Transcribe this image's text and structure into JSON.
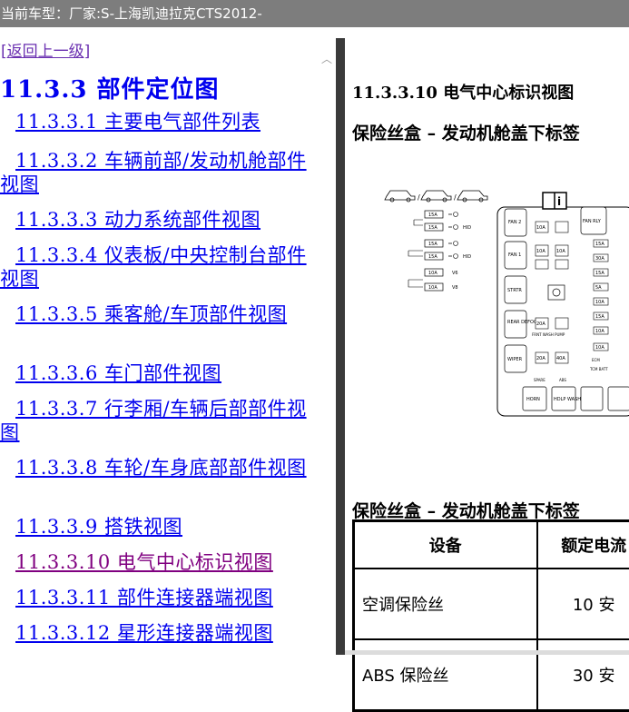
{
  "window": {
    "title": "当前车型：厂家:S-上海凯迪拉克CTS2012-"
  },
  "nav": {
    "back_label": "[返回上一级]",
    "section_title": "11.3.3 部件定位图",
    "items": [
      {
        "label": "11.3.3.1 主要电气部件列表",
        "visited": false
      },
      {
        "label": "11.3.3.2 车辆前部/发动机舱部件视图",
        "visited": false
      },
      {
        "label": "11.3.3.3 动力系统部件视图",
        "visited": false
      },
      {
        "label": "11.3.3.4 仪表板/中央控制台部件视图",
        "visited": false
      },
      {
        "label": "11.3.3.5 乘客舱/车顶部件视图",
        "visited": false
      },
      {
        "label": "11.3.3.6 车门部件视图",
        "visited": false
      },
      {
        "label": "11.3.3.7 行李厢/车辆后部部件视图",
        "visited": false
      },
      {
        "label": "11.3.3.8 车轮/车身底部部件视图",
        "visited": false
      },
      {
        "label": "11.3.3.9 搭铁视图",
        "visited": false
      },
      {
        "label": "11.3.3.10 电气中心标识视图",
        "visited": true
      },
      {
        "label": "11.3.3.11 部件连接器端视图",
        "visited": false
      },
      {
        "label": "11.3.3.12 星形连接器端视图",
        "visited": false
      }
    ]
  },
  "content": {
    "heading": "11.3.3.10 电气中心标识视图",
    "subheading_1": "保险丝盒 – 发动机舱盖下标签",
    "subheading_2": "保险丝盒 – 发动机舱盖下标签",
    "diagram": {
      "legend_labels": [
        "15A",
        "15A",
        "15A",
        "15A",
        "10A",
        "10A"
      ],
      "legend_marks": [
        "HID",
        "HID",
        "V6",
        "V8"
      ],
      "fuse_labels": {
        "fan2": "FAN 2",
        "fan1": "FAN 1",
        "starter": "STRTR",
        "rear_defog": "REAR DEFOG",
        "wiper": "WIPER",
        "fan_relay": "FAN RLY",
        "horn": "HORN",
        "hdlp_wash": "HDLP WASH",
        "pump": "FRNT WASH PUMP",
        "abs": "ABS",
        "spare": "SPARE",
        "ecm": "ECM",
        "tcm_batt": "TCM BATT",
        "a20": "20A",
        "a30": "30A",
        "a40": "40A",
        "a15": "15A",
        "a10": "10A",
        "a5": "5A"
      }
    },
    "table": {
      "headers": [
        "设备",
        "额定电流"
      ],
      "rows": [
        [
          "空调保险丝",
          "10 安"
        ],
        [
          "ABS 保险丝",
          "30 安"
        ]
      ]
    }
  },
  "colors": {
    "titlebar_bg": "#7d7d7d",
    "link": "#0000ee",
    "visited": "#800080",
    "back_link": "#6a2fb0",
    "divider": "#3a3a3a"
  }
}
